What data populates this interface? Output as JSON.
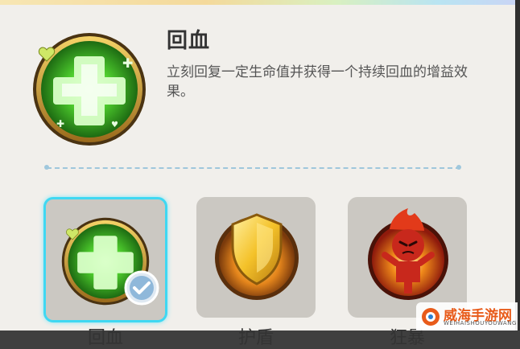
{
  "skill": {
    "title": "回血",
    "description": "立刻回复一定生命值并获得一个持续回血的增益效果。"
  },
  "cards": [
    {
      "label": "回血",
      "icon": "heal-plus-icon",
      "selected": true
    },
    {
      "label": "护盾",
      "icon": "shield-icon",
      "selected": false
    },
    {
      "label": "狂暴",
      "icon": "rage-demon-icon",
      "selected": false
    }
  ],
  "watermark": {
    "text": "威海手游网",
    "sub": "WEIHAISHOUYOUWANG"
  },
  "colors": {
    "panel_bg": "#f1efeb",
    "selected_border": "#3fd8f2",
    "heal_green": "#5be64a",
    "shield_gold": "#f1b81c",
    "rage_red": "#c8281c"
  }
}
